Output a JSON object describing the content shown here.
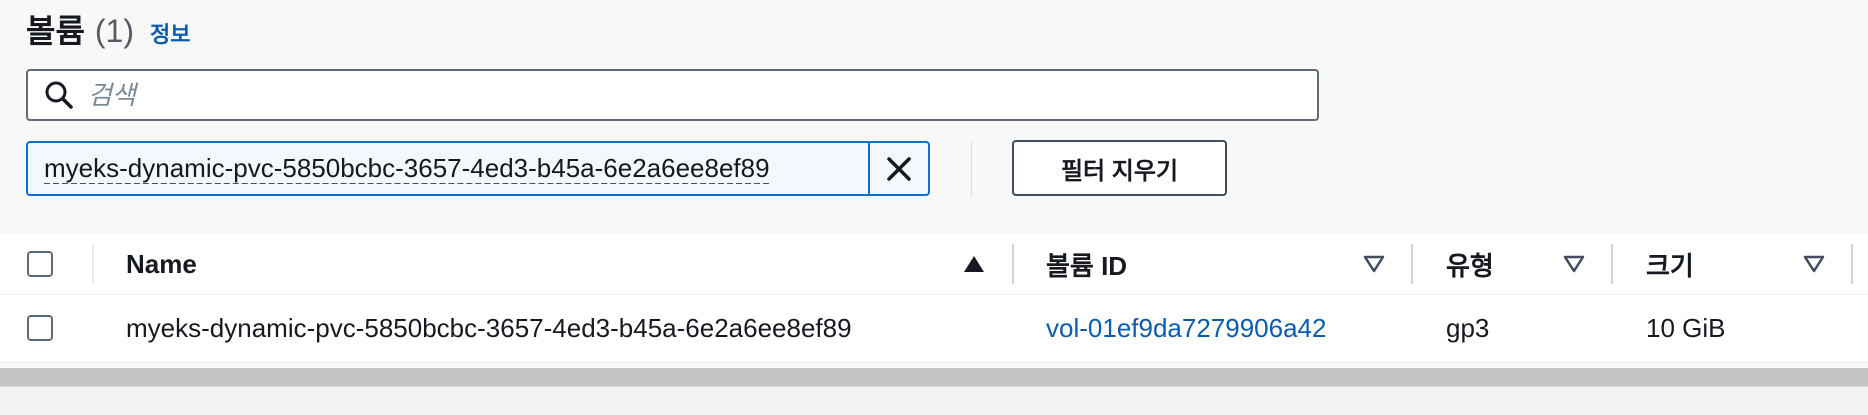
{
  "header": {
    "title": "볼륨",
    "count": "(1)",
    "info": "정보"
  },
  "search": {
    "placeholder": "검색",
    "value": ""
  },
  "filter": {
    "token": "myeks-dynamic-pvc-5850bcbc-3657-4ed3-b45a-6e2a6ee8ef89",
    "clear_label": "필터 지우기"
  },
  "table": {
    "columns": [
      {
        "label": "Name",
        "sort": "ascending"
      },
      {
        "label": "볼륨 ID",
        "sort": "none"
      },
      {
        "label": "유형",
        "sort": "none"
      },
      {
        "label": "크기",
        "sort": "none"
      }
    ],
    "rows": [
      {
        "name": "myeks-dynamic-pvc-5850bcbc-3657-4ed3-b45a-6e2a6ee8ef89",
        "volume_id": "vol-01ef9da7279906a42",
        "type": "gp3",
        "size": "10 GiB"
      }
    ]
  },
  "colors": {
    "link": "#0b5cad",
    "accent": "#0972d3",
    "text": "#16191f"
  }
}
